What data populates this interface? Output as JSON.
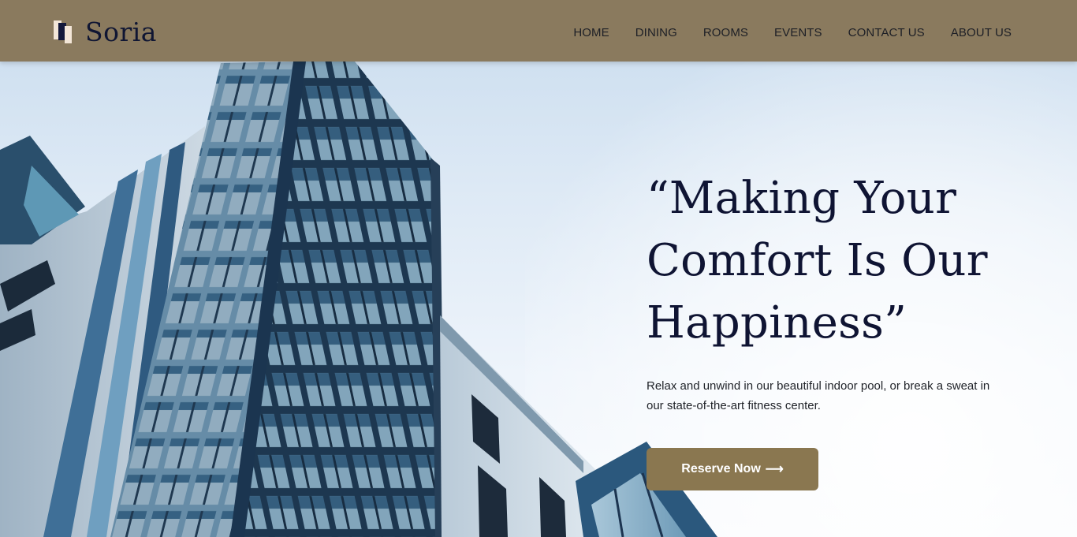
{
  "brand": {
    "name": "Soria",
    "logo_icon": "bars-logo-icon"
  },
  "nav": {
    "items": [
      {
        "label": "HOME"
      },
      {
        "label": "DINING"
      },
      {
        "label": "ROOMS"
      },
      {
        "label": "EVENTS"
      },
      {
        "label": "CONTACT US"
      },
      {
        "label": "ABOUT US"
      }
    ]
  },
  "hero": {
    "title_line1": "“Making Your",
    "title_line2": "Comfort Is Our",
    "title_line3": "Happiness”",
    "description_line1": "Relax and unwind in our beautiful indoor pool, or break a sweat in",
    "description_line2": "our state-of-the-art fitness center.",
    "cta_label": "Reserve Now",
    "cta_icon": "arrow-right-icon",
    "background_image": "building-photo"
  },
  "colors": {
    "header_bg": "#8a7a5e",
    "title": "#0f1433",
    "button_bg": "#8a7750",
    "logo_dark": "#13183a",
    "logo_light": "#f3e6d8"
  }
}
